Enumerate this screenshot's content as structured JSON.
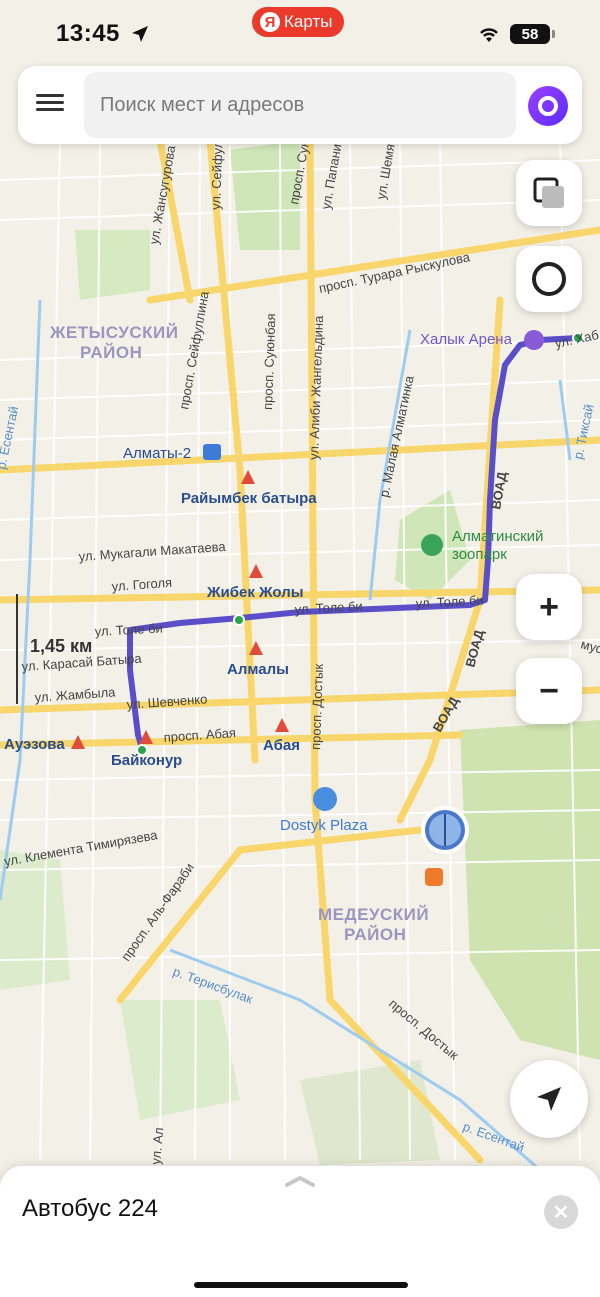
{
  "status_bar": {
    "time": "13:45",
    "app_name": "Карты",
    "app_logo": "Я",
    "battery": "58"
  },
  "search": {
    "placeholder": "Поиск мест и адресов"
  },
  "map": {
    "districts": [
      "ЖЕТЫСУСКИЙ",
      "РАЙОН",
      "МЕДЕУСКИЙ",
      "РАЙОН"
    ],
    "stations": [
      "Райымбек батыра",
      "Жибек Жолы",
      "Алмалы",
      "Абая",
      "Байконур",
      "Ауэзова"
    ],
    "places": [
      "Алматы-2",
      "Халык Арена",
      "Алматинский",
      "зоопарк",
      "Dostyk Plaza"
    ],
    "streets": [
      "ул. Жансугурова",
      "ул. Сейфуллина",
      "просп. Сейфуллина",
      "просп. Суюнбая",
      "просп. Суюнбая",
      "ул. Папанина",
      "ул. Шемякина",
      "просп. Турара Рыскулова",
      "ул. Алиби Жангельдина",
      "р. Малая Алматинка",
      "ул. Мукагали Макатаева",
      "ул. Гоголя",
      "ул. Толе би",
      "ул. Толе би",
      "ул. Толе би",
      "ул. Карасай Батыра",
      "ул. Жамбыла",
      "ул. Шевченко",
      "просп. Абая",
      "просп. Достык",
      "ул. Клемента Тимирязева",
      "просп. Аль-Фараби",
      "р. Терисбулак",
      "просп. Достык",
      "ВОАД",
      "ВОАД",
      "ВОАД",
      "р. Есентай",
      "р. Есентай",
      "р. Тиксай",
      "ул. Хаб",
      "мус",
      "ул. Ал"
    ],
    "scale_label": "1,45 км",
    "route_color": "#5b4fc9"
  },
  "zoom": {
    "in": "+",
    "out": "−"
  },
  "bottom_sheet": {
    "title": "Автобус 224"
  }
}
